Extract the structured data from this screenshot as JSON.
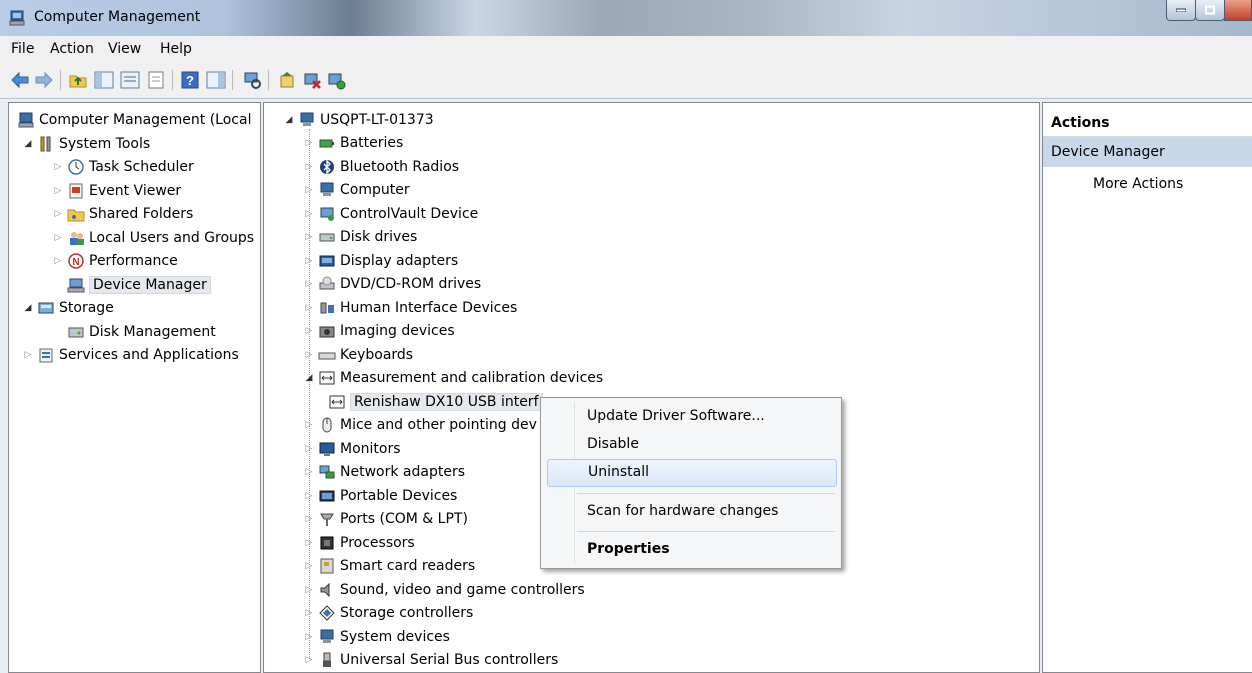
{
  "window": {
    "title": "Computer Management"
  },
  "menu": [
    "File",
    "Action",
    "View",
    "Help"
  ],
  "left_tree": [
    {
      "label": "Computer Management (Local",
      "indent": 0,
      "exp": "",
      "icon": "computer-management-icon"
    },
    {
      "label": "System Tools",
      "indent": 1,
      "exp": "open",
      "icon": "tools-icon"
    },
    {
      "label": "Task Scheduler",
      "indent": 2,
      "exp": "closed",
      "icon": "clock-icon"
    },
    {
      "label": "Event Viewer",
      "indent": 2,
      "exp": "closed",
      "icon": "event-viewer-icon"
    },
    {
      "label": "Shared Folders",
      "indent": 2,
      "exp": "closed",
      "icon": "shared-folder-icon"
    },
    {
      "label": "Local Users and Groups",
      "indent": 2,
      "exp": "closed",
      "icon": "users-icon"
    },
    {
      "label": "Performance",
      "indent": 2,
      "exp": "closed",
      "icon": "performance-icon"
    },
    {
      "label": "Device Manager",
      "indent": 2,
      "exp": "",
      "icon": "device-manager-icon",
      "selected": true
    },
    {
      "label": "Storage",
      "indent": 1,
      "exp": "open",
      "icon": "storage-icon"
    },
    {
      "label": "Disk Management",
      "indent": 2,
      "exp": "",
      "icon": "disk-management-icon"
    },
    {
      "label": "Services and Applications",
      "indent": 1,
      "exp": "closed",
      "icon": "services-icon"
    }
  ],
  "device_tree": {
    "root": "USQPT-LT-01373",
    "categories": [
      {
        "label": "Batteries",
        "icon": "battery-icon"
      },
      {
        "label": "Bluetooth Radios",
        "icon": "bluetooth-icon"
      },
      {
        "label": "Computer",
        "icon": "computer-icon"
      },
      {
        "label": "ControlVault Device",
        "icon": "controlvault-icon"
      },
      {
        "label": "Disk drives",
        "icon": "disk-drive-icon"
      },
      {
        "label": "Display adapters",
        "icon": "display-adapter-icon"
      },
      {
        "label": "DVD/CD-ROM drives",
        "icon": "dvd-icon"
      },
      {
        "label": "Human Interface Devices",
        "icon": "hid-icon"
      },
      {
        "label": "Imaging devices",
        "icon": "camera-icon"
      },
      {
        "label": "Keyboards",
        "icon": "keyboard-icon"
      },
      {
        "label": "Measurement and calibration devices",
        "icon": "measurement-icon",
        "expanded": true
      },
      {
        "label": "Renishaw DX10 USB interf",
        "icon": "measurement-device-icon",
        "child": true,
        "selected": true
      },
      {
        "label": "Mice and other pointing dev",
        "icon": "mouse-icon"
      },
      {
        "label": "Monitors",
        "icon": "monitor-icon"
      },
      {
        "label": "Network adapters",
        "icon": "network-icon"
      },
      {
        "label": "Portable Devices",
        "icon": "portable-device-icon"
      },
      {
        "label": "Ports (COM & LPT)",
        "icon": "port-icon"
      },
      {
        "label": "Processors",
        "icon": "processor-icon"
      },
      {
        "label": "Smart card readers",
        "icon": "smart-card-icon"
      },
      {
        "label": "Sound, video and game controllers",
        "icon": "sound-icon"
      },
      {
        "label": "Storage controllers",
        "icon": "storage-controller-icon"
      },
      {
        "label": "System devices",
        "icon": "system-device-icon"
      },
      {
        "label": "Universal Serial Bus controllers",
        "icon": "usb-icon"
      }
    ]
  },
  "actions": {
    "header": "Actions",
    "section": "Device Manager",
    "more": "More Actions"
  },
  "context_menu": {
    "items": [
      "Update Driver Software...",
      "Disable",
      "Uninstall",
      "Scan for hardware changes",
      "Properties"
    ],
    "hovered": "Uninstall",
    "bold": "Properties"
  },
  "colors": {
    "selection": "#e5e9ee",
    "actions_section": "#c9d7ea",
    "menu_hover": "#dce8f8"
  }
}
